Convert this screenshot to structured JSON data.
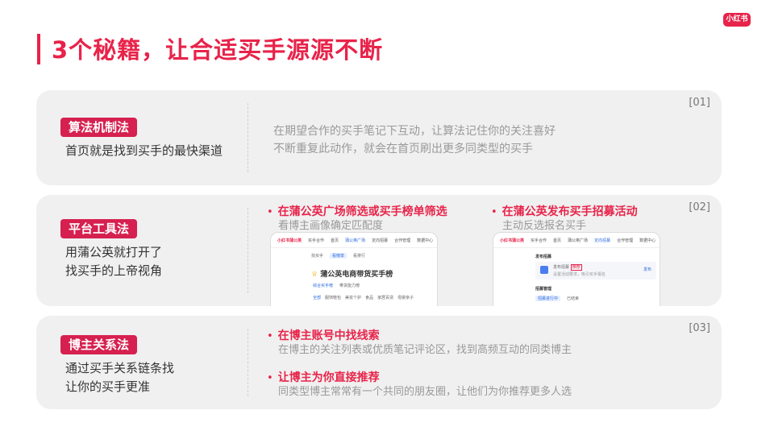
{
  "logo": "小红书",
  "title": "3个秘籍，让合适买手源源不断",
  "cards": [
    {
      "num": "[01]",
      "tag": "算法机制法",
      "sub": [
        "首页就是找到买手的最快渠道"
      ],
      "desc": [
        "在期望合作的买手笔记下互动，让算法记住你的关注喜好",
        "不断重复此动作，就会在首页刷出更多同类型的买手"
      ]
    },
    {
      "num": "[02]",
      "tag": "平台工具法",
      "sub": [
        "用蒲公英就打开了",
        "找买手的上帝视角"
      ],
      "bullets": [
        {
          "h": "在蒲公英广场筛选或买手榜单筛选",
          "d": "看博主画像确定匹配度"
        },
        {
          "h": "在蒲公英发布买手招募活动",
          "d": "主动反选报名买手"
        }
      ],
      "shot1": {
        "brand": "小红书蒲公英",
        "nav": [
          "买手合作",
          "首页",
          "蒲公英广场",
          "定向招募",
          "合作管理",
          "数据中心"
        ],
        "tabs": [
          "找买手",
          "看榜单",
          "看排行"
        ],
        "list_title": "蒲公英电商带货买手榜",
        "subtabs": [
          "综合买手榜",
          "带货能力榜"
        ],
        "filters": [
          "全部",
          "服饰鞋包",
          "美妆个护",
          "食品",
          "家居百货",
          "母婴亲子"
        ]
      },
      "shot2": {
        "brand": "小红书蒲公英",
        "nav": [
          "买手合作",
          "首页",
          "蒲公英广场",
          "定向招募",
          "合作管理",
          "数据中心"
        ],
        "section1": "发布招募",
        "item": "发布招募",
        "badge": "推荐",
        "item_desc": "设置活动要求，吸引买手报名",
        "btn": "发布",
        "section2": "招募管理",
        "tabs": [
          "招募进行中",
          "已结束"
        ]
      }
    },
    {
      "num": "[03]",
      "tag": "博主关系法",
      "sub": [
        "通过买手关系链条找",
        "让你的买手更准"
      ],
      "bullets": [
        {
          "h": "在博主账号中找线索",
          "d": "在博主的关注列表或优质笔记评论区，找到高频互动的同类博主"
        },
        {
          "h": "让博主为你直接推荐",
          "d": "同类型博主常常有一个共同的朋友圈，让他们为你推荐更多人选"
        }
      ]
    }
  ]
}
